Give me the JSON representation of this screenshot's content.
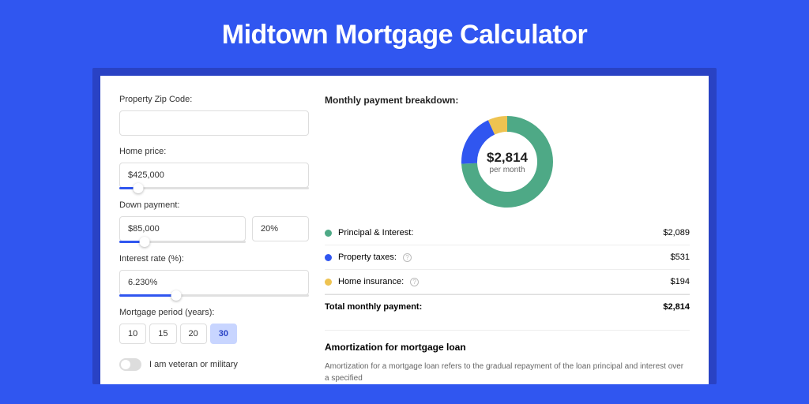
{
  "title": "Midtown Mortgage Calculator",
  "form": {
    "zip": {
      "label": "Property Zip Code:",
      "value": ""
    },
    "home_price": {
      "label": "Home price:",
      "value": "$425,000",
      "slider_pct": 10
    },
    "down_payment": {
      "label": "Down payment:",
      "amount": "$85,000",
      "percent": "20%",
      "slider_pct": 20
    },
    "interest_rate": {
      "label": "Interest rate (%):",
      "value": "6.230%",
      "slider_pct": 30
    },
    "period": {
      "label": "Mortgage period (years):",
      "options": [
        "10",
        "15",
        "20",
        "30"
      ],
      "selected": "30"
    },
    "veteran": {
      "label": "I am veteran or military",
      "checked": false
    }
  },
  "breakdown": {
    "title": "Monthly payment breakdown:",
    "donut": {
      "amount": "$2,814",
      "sub": "per month"
    },
    "rows": [
      {
        "label": "Principal & Interest:",
        "value": "$2,089",
        "color": "green",
        "info": false
      },
      {
        "label": "Property taxes:",
        "value": "$531",
        "color": "blue",
        "info": true
      },
      {
        "label": "Home insurance:",
        "value": "$194",
        "color": "yellow",
        "info": true
      }
    ],
    "total": {
      "label": "Total monthly payment:",
      "value": "$2,814"
    }
  },
  "amort": {
    "title": "Amortization for mortgage loan",
    "text": "Amortization for a mortgage loan refers to the gradual repayment of the loan principal and interest over a specified"
  },
  "chart_data": {
    "type": "pie",
    "title": "Monthly payment breakdown",
    "series": [
      {
        "name": "Principal & Interest",
        "value": 2089,
        "color": "#4ea986"
      },
      {
        "name": "Property taxes",
        "value": 531,
        "color": "#3056f0"
      },
      {
        "name": "Home insurance",
        "value": 194,
        "color": "#eec351"
      }
    ],
    "total": 2814
  }
}
